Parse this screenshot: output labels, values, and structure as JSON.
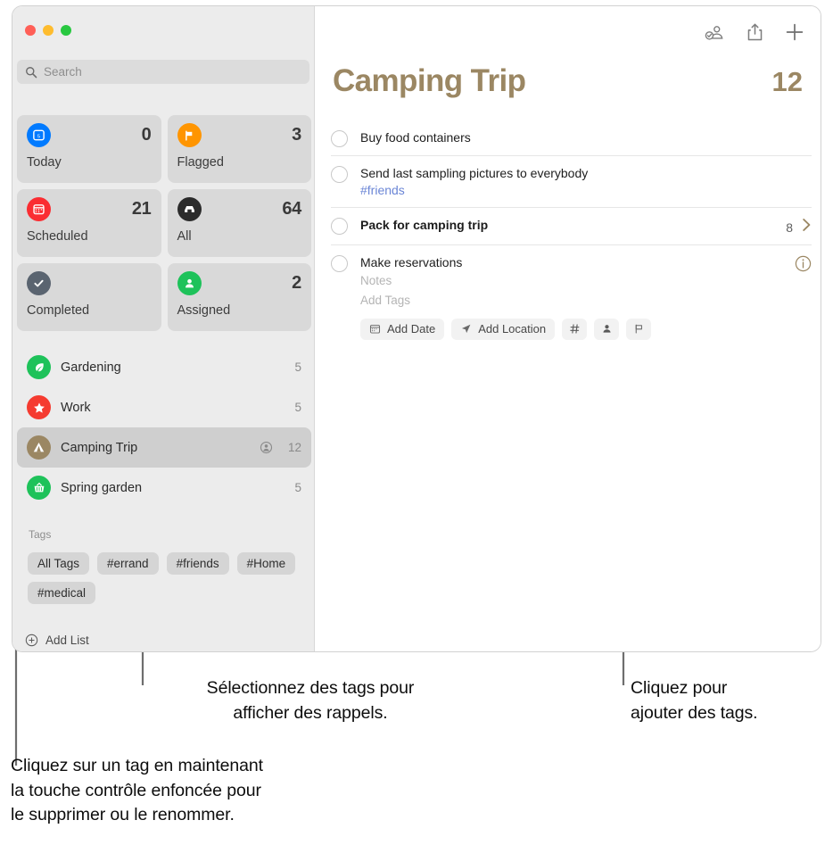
{
  "window": {
    "traffic_lights": [
      "close",
      "minimize",
      "zoom"
    ]
  },
  "sidebar": {
    "search": {
      "placeholder": "Search",
      "value": ""
    },
    "smart_lists": [
      {
        "label": "Today",
        "count": "0",
        "icon": "calendar-day-icon",
        "color": "#007aff"
      },
      {
        "label": "Flagged",
        "count": "3",
        "icon": "flag-icon",
        "color": "#ff9500"
      },
      {
        "label": "Scheduled",
        "count": "21",
        "icon": "calendar-icon",
        "color": "#fa2d32"
      },
      {
        "label": "All",
        "count": "64",
        "icon": "inbox-icon",
        "color": "#2b2b2b"
      },
      {
        "label": "Completed",
        "count": "",
        "icon": "checkmark-icon",
        "color": "#5a6470"
      },
      {
        "label": "Assigned",
        "count": "2",
        "icon": "person-icon",
        "color": "#1ec25a"
      }
    ],
    "lists": [
      {
        "name": "Gardening",
        "count": "5",
        "icon": "leaf-icon",
        "color": "#1ec25a",
        "selected": false,
        "shared": false
      },
      {
        "name": "Work",
        "count": "5",
        "icon": "star-icon",
        "color": "#f53b30",
        "selected": false,
        "shared": false
      },
      {
        "name": "Camping Trip",
        "count": "12",
        "icon": "tent-icon",
        "color": "#9b8763",
        "selected": true,
        "shared": true
      },
      {
        "name": "Spring garden",
        "count": "5",
        "icon": "basket-icon",
        "color": "#1ec25a",
        "selected": false,
        "shared": false
      }
    ],
    "tags_header": "Tags",
    "tags": [
      "All Tags",
      "#errand",
      "#friends",
      "#Home",
      "#medical"
    ],
    "add_list_label": "Add List"
  },
  "toolbar": {
    "assigned_icon": "person-checkmark-icon",
    "share_icon": "share-icon",
    "add_icon": "plus-icon"
  },
  "main": {
    "title": "Camping Trip",
    "count": "12",
    "accent_color": "#9b8763",
    "reminders": [
      {
        "title": "Buy food containers",
        "bold": false,
        "tag": "",
        "notes_placeholder": "",
        "tags_placeholder": "",
        "trailing_count": "",
        "has_chevron": false,
        "has_info": false,
        "expanded": false
      },
      {
        "title": "Send last sampling pictures to everybody",
        "bold": false,
        "tag": "#friends",
        "notes_placeholder": "",
        "tags_placeholder": "",
        "trailing_count": "",
        "has_chevron": false,
        "has_info": false,
        "expanded": false
      },
      {
        "title": "Pack for camping trip",
        "bold": true,
        "tag": "",
        "notes_placeholder": "",
        "tags_placeholder": "",
        "trailing_count": "8",
        "has_chevron": true,
        "has_info": false,
        "expanded": false
      },
      {
        "title": "Make reservations",
        "bold": false,
        "tag": "",
        "notes_placeholder": "Notes",
        "tags_placeholder": "Add Tags",
        "trailing_count": "",
        "has_chevron": false,
        "has_info": true,
        "expanded": true
      }
    ],
    "detail_chips": [
      {
        "label": "Add Date",
        "icon": "calendar-icon"
      },
      {
        "label": "Add Location",
        "icon": "location-arrow-icon"
      },
      {
        "label": "",
        "icon": "hash-icon"
      },
      {
        "label": "",
        "icon": "person-icon"
      },
      {
        "label": "",
        "icon": "flag-outline-icon"
      }
    ]
  },
  "annotations": [
    {
      "id": "tags-select",
      "line1": "Sélectionnez des tags pour",
      "line2": "afficher des rappels.",
      "line3": ""
    },
    {
      "id": "tags-context",
      "line1": "Cliquez sur un tag en maintenant",
      "line2": "la touche contrôle enfoncée pour",
      "line3": "le supprimer ou le renommer."
    },
    {
      "id": "add-tags",
      "line1": "Cliquez pour",
      "line2": "ajouter des tags.",
      "line3": ""
    }
  ]
}
